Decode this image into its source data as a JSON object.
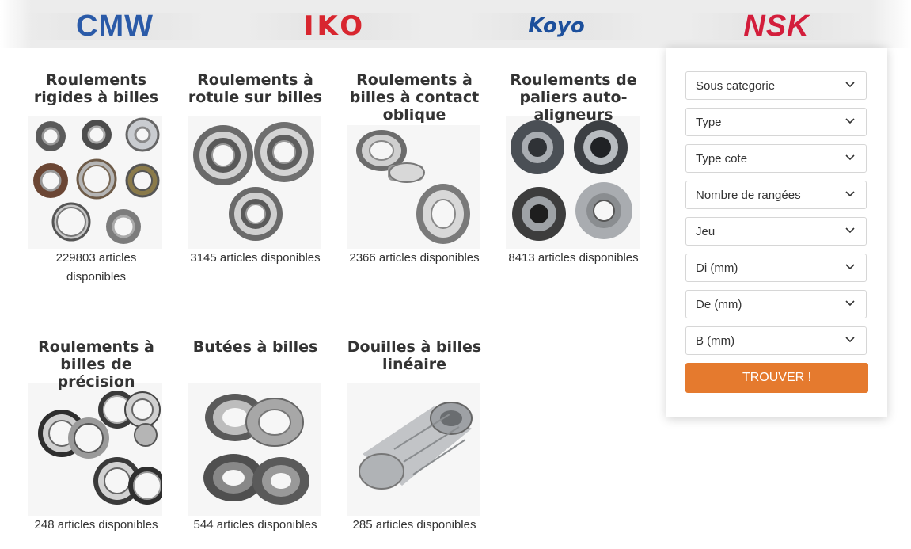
{
  "brands": [
    {
      "name": "CMW"
    },
    {
      "name": "IKO"
    },
    {
      "name": "Koyo"
    },
    {
      "name": "NSK"
    }
  ],
  "products": [
    {
      "title": "Roulements rigides à billes",
      "count": "229803 articles disponibles"
    },
    {
      "title": "Roulements à rotule sur billes",
      "count": "3145 articles disponibles"
    },
    {
      "title": "Roulements à billes à contact oblique",
      "count": "2366 articles disponibles"
    },
    {
      "title": "Roulements de paliers auto-aligneurs",
      "count": "8413 articles disponibles"
    },
    {
      "title": "Roulements à billes de précision",
      "count": "248 articles disponibles"
    },
    {
      "title": "Butées à billes",
      "count": "544 articles disponibles"
    },
    {
      "title": "Douilles à billes linéaire",
      "count": "285 articles disponibles"
    }
  ],
  "filters": {
    "selects": [
      "Sous categorie",
      "Type",
      "Type cote",
      "Nombre de rangées",
      "Jeu",
      "Di (mm)",
      "De (mm)",
      "B (mm)"
    ],
    "submit_label": "TROUVER !"
  },
  "colors": {
    "accent": "#e57a2e",
    "cmw": "#2a5aa8",
    "iko": "#d8262f",
    "koyo": "#1c4f9c",
    "nsk": "#d31d3b"
  },
  "icons": {
    "select_chevron": "chevron-down-icon"
  }
}
